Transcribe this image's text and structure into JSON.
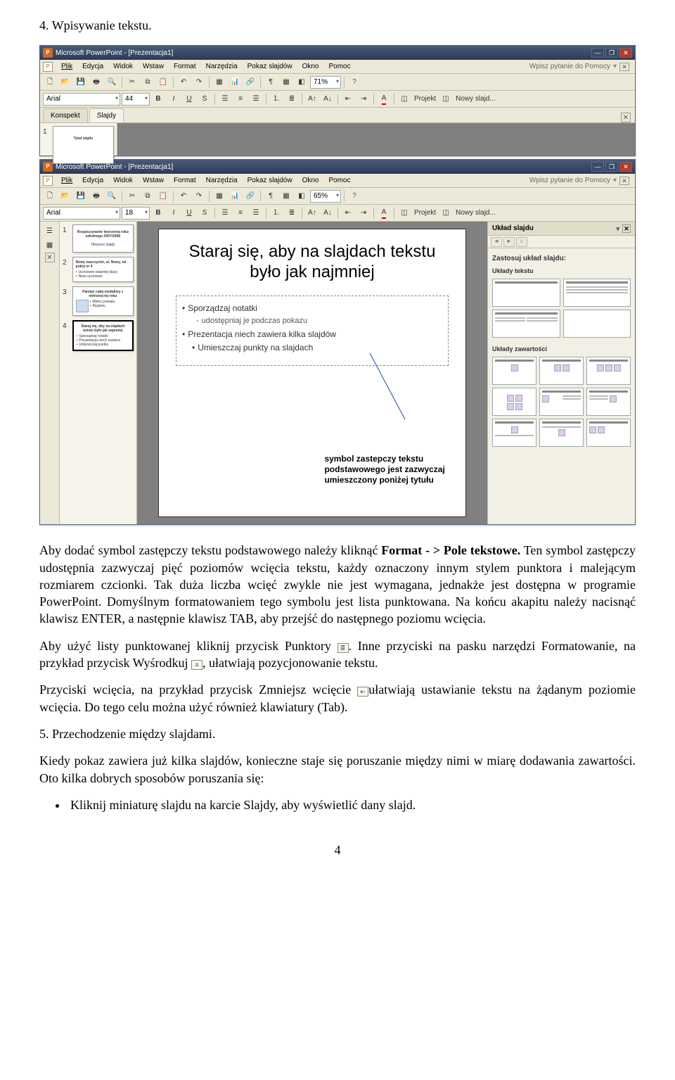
{
  "heading4": "4.  Wpisywanie tekstu.",
  "titlebar": "Microsoft PowerPoint - [Prezentacja1]",
  "menubar": {
    "file": "Plik",
    "edit": "Edycja",
    "view": "Widok",
    "insert": "Wstaw",
    "format": "Format",
    "tools": "Narzędzia",
    "slideshow": "Pokaz slajdów",
    "window": "Okno",
    "help": "Pomoc",
    "helpBox": "Wpisz pytanie do Pomocy"
  },
  "toolbar1": {
    "zoom1": "71%",
    "zoom2": "65%",
    "font": "Arial",
    "size1": "44",
    "size2": "18",
    "projekt": "Projekt",
    "nowy": "Nowy slajd..."
  },
  "outline": {
    "konspekt": "Konspekt",
    "slajdy": "Slajdy"
  },
  "slide": {
    "title": "Staraj się, aby na slajdach tekstu było jak najmniej",
    "b1": "Sporządzaj notatki",
    "b1s": "udostępniaj je podczas pokazu",
    "b2": "Prezentacja niech zawiera kilka slajdów",
    "b2s": "Umieszczaj punkty na slajdach"
  },
  "callout": "symbol zastepczy tekstu podstawowego jest zazwyczaj umieszczony poniżej tytułu",
  "taskpane": {
    "title": "Układ slajdu",
    "apply": "Zastosuj układ slajdu:",
    "textLayouts": "Układy tekstu",
    "contentLayouts": "Układy zawartości"
  },
  "p1": "Aby dodać symbol zastępczy tekstu podstawowego należy kliknąć Format - > Pole tekstowe. Ten symbol zastępczy udostępnia zazwyczaj pięć poziomów wcięcia tekstu, każdy oznaczony innym stylem punktora i malejącym rozmiarem czcionki. Tak duża liczba wcięć zwykle nie jest wymagana, jednakże jest dostępna w programie PowerPoint. Domyślnym formatowaniem tego symbolu jest lista punktowana. Na końcu akapitu należy nacisnąć klawisz ENTER, a następnie klawisz TAB, aby przejść do następnego poziomu wcięcia.",
  "p2a": "Aby użyć listy punktowanej kliknij przycisk Punktory ",
  "p2b": ". Inne przyciski na pasku narzędzi Formatowanie, na przykład przycisk Wyśrodkuj ",
  "p2c": ", ułatwiają pozycjonowanie tekstu.",
  "p3a": "Przyciski wcięcia, na przykład przycisk Zmniejsz wcięcie ",
  "p3b": "ułatwiają ustawianie tekstu na żądanym poziomie wcięcia. Do tego celu można użyć również klawiatury (Tab).",
  "heading5": "5.  Przechodzenie między slajdami.",
  "p4": "Kiedy pokaz zawiera już kilka slajdów, konieczne staje się poruszanie między nimi w miarę dodawania zawartości. Oto kilka dobrych sposobów poruszania się:",
  "bullet1": "Kliknij miniaturę slajdu na karcie Slajdy, aby wyświetlić dany slajd.",
  "pageNum": "4"
}
